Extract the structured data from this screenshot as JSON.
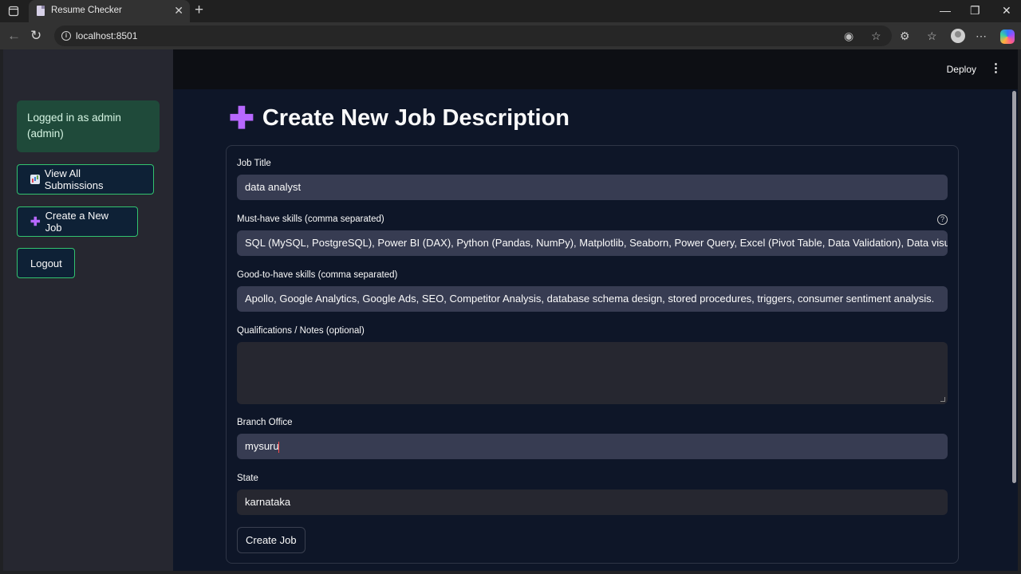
{
  "browser": {
    "tab_title": "Resume Checker",
    "url": "localhost:8501"
  },
  "header": {
    "deploy_label": "Deploy"
  },
  "sidebar": {
    "login_status": "Logged in as admin (admin)",
    "buttons": [
      {
        "label": "View All Submissions",
        "icon": "bar-chart-icon"
      },
      {
        "label": "Create a New Job",
        "icon": "plus-icon"
      },
      {
        "label": "Logout"
      }
    ],
    "accent_color": "#32c36f"
  },
  "main": {
    "title": "Create New Job Description",
    "title_icon": "plus-icon",
    "form": {
      "job_title": {
        "label": "Job Title",
        "value": "data analyst"
      },
      "must_have": {
        "label": "Must-have skills (comma separated)",
        "value": "SQL (MySQL, PostgreSQL), Power BI (DAX), Python (Pandas, NumPy), Matplotlib, Seaborn, Power Query, Excel (Pivot Table, Data Validation), Data visualization,"
      },
      "good_to_have": {
        "label": "Good-to-have skills (comma separated)",
        "value": "Apollo, Google Analytics, Google Ads, SEO, Competitor Analysis, database schema design, stored procedures, triggers, consumer sentiment analysis."
      },
      "qualifications": {
        "label": "Qualifications / Notes (optional)",
        "value": ""
      },
      "branch": {
        "label": "Branch Office",
        "value": "mysuru"
      },
      "state": {
        "label": "State",
        "value": "karnataka"
      },
      "submit_label": "Create Job"
    }
  }
}
